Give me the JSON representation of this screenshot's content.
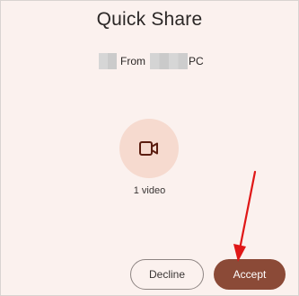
{
  "dialog": {
    "title": "Quick Share",
    "from_label": "From",
    "source_suffix": "PC"
  },
  "transfer": {
    "icon": "video-camera-icon",
    "count_text": "1 video"
  },
  "actions": {
    "decline_label": "Decline",
    "accept_label": "Accept"
  },
  "colors": {
    "background": "#fbf1ee",
    "icon_circle": "#f6dacf",
    "icon_stroke": "#5b1d10",
    "accept_button": "#8b4a37",
    "annotation_arrow": "#e01717"
  }
}
